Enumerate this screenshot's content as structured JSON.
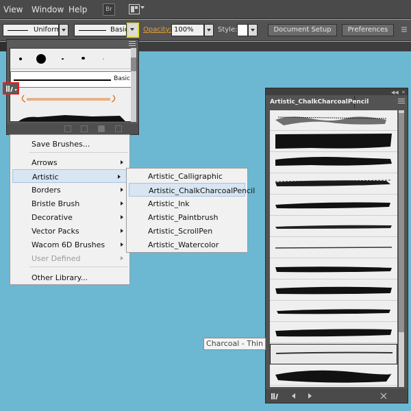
{
  "menubar": {
    "items": [
      "View",
      "Window",
      "Help"
    ],
    "bridge_badge": "Br"
  },
  "controlbar": {
    "stroke_profile": "Uniform",
    "brush_definition": "Basic",
    "opacity_label": "Opacity:",
    "opacity_value": "100%",
    "style_label": "Style:",
    "document_setup_label": "Document Setup",
    "preferences_label": "Preferences"
  },
  "brush_popup": {
    "basic_label": "Basic"
  },
  "context_menu": {
    "items": [
      {
        "label": "Save Brushes...",
        "has_submenu": false,
        "disabled": false
      },
      {
        "label": "Arrows",
        "has_submenu": true,
        "disabled": false
      },
      {
        "label": "Artistic",
        "has_submenu": true,
        "disabled": false,
        "highlighted": true
      },
      {
        "label": "Borders",
        "has_submenu": true,
        "disabled": false
      },
      {
        "label": "Bristle Brush",
        "has_submenu": true,
        "disabled": false
      },
      {
        "label": "Decorative",
        "has_submenu": true,
        "disabled": false
      },
      {
        "label": "Vector Packs",
        "has_submenu": true,
        "disabled": false
      },
      {
        "label": "Wacom 6D Brushes",
        "has_submenu": true,
        "disabled": false
      },
      {
        "label": "User Defined",
        "has_submenu": true,
        "disabled": true
      },
      {
        "label": "Other Library...",
        "has_submenu": false,
        "disabled": false
      }
    ]
  },
  "submenu": {
    "items": [
      {
        "label": "Artistic_Calligraphic"
      },
      {
        "label": "Artistic_ChalkCharcoalPencil",
        "highlighted": true
      },
      {
        "label": "Artistic_Ink"
      },
      {
        "label": "Artistic_Paintbrush"
      },
      {
        "label": "Artistic_ScrollPen"
      },
      {
        "label": "Artistic_Watercolor"
      }
    ]
  },
  "library_panel": {
    "title": "Artistic_ChalkCharcoalPencil"
  },
  "tooltip": {
    "text": "Charcoal - Thin"
  },
  "colors": {
    "canvas": "#6cb8d2",
    "highlight_border_red": "#e0211f",
    "highlight_border_yellow": "#e5dd2a",
    "opacity_orange": "#e8a13b",
    "menu_hover": "#d8e5f2"
  }
}
